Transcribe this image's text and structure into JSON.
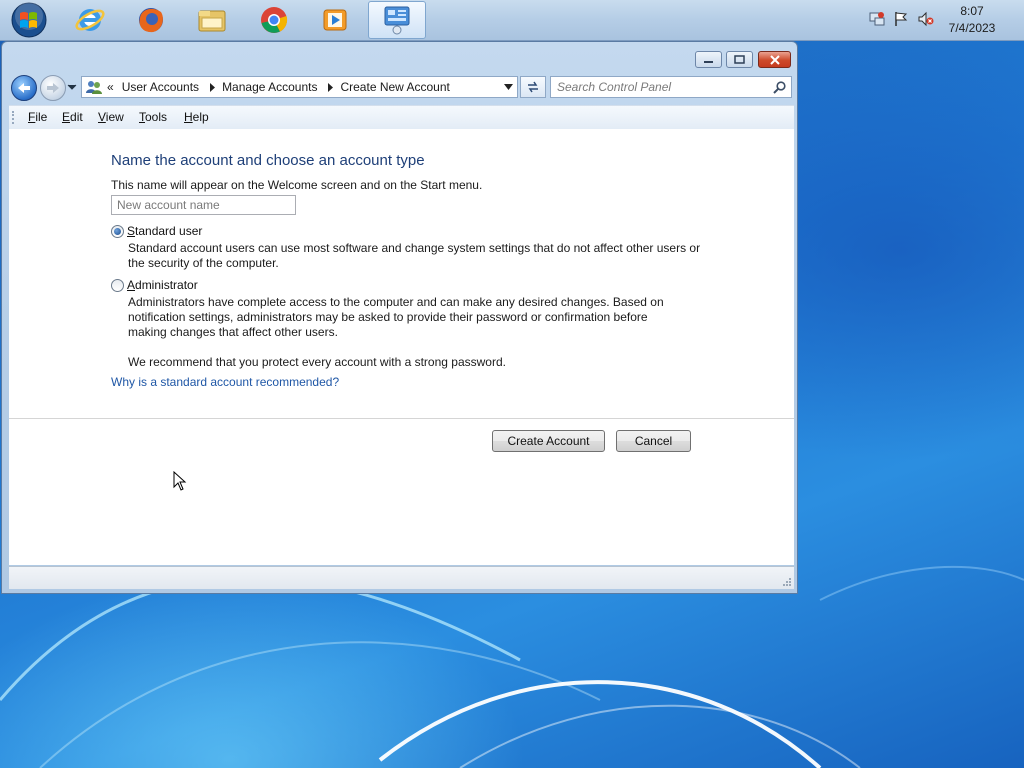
{
  "taskbar": {
    "apps": [
      {
        "name": "Start"
      },
      {
        "name": "Internet Explorer"
      },
      {
        "name": "Firefox"
      },
      {
        "name": "Windows Explorer"
      },
      {
        "name": "Chrome"
      },
      {
        "name": "Windows Media Player"
      },
      {
        "name": "Control Panel",
        "active": true
      }
    ],
    "clock": {
      "time": "8:07",
      "date": "7/4/2023"
    }
  },
  "window": {
    "breadcrumb": [
      "User Accounts",
      "Manage Accounts",
      "Create New Account"
    ],
    "breadcrumb_overflow": "«",
    "search": {
      "placeholder": "Search Control Panel"
    },
    "menu": {
      "file": {
        "ul": "F",
        "rest": "ile"
      },
      "edit": {
        "ul": "E",
        "rest": "dit"
      },
      "view": {
        "ul": "V",
        "rest": "iew"
      },
      "tools": {
        "ul": "T",
        "rest": "ools"
      },
      "help": {
        "ul": "H",
        "rest": "elp"
      }
    },
    "content": {
      "heading": "Name the account and choose an account type",
      "intro": "This name will appear on the Welcome screen and on the Start menu.",
      "name_field": {
        "placeholder": "New account name",
        "value": ""
      },
      "standard": {
        "label_ul": "S",
        "label_rest": "tandard user",
        "selected": true,
        "desc_1": "Standard account users can use most software and change system settings that do not affect other users or",
        "desc_2": "the security of the computer."
      },
      "admin": {
        "label_ul": "A",
        "label_rest": "dministrator",
        "selected": false,
        "desc_1": "Administrators have complete access to the computer and can make any desired changes. Based on",
        "desc_2": "notification settings, administrators may be asked to provide their password or confirmation before",
        "desc_3": "making changes that affect other users.",
        "recommend": "We recommend that you protect every account with a strong password."
      },
      "why_link": "Why is a standard account recommended?",
      "create_button": "Create Account",
      "cancel_button": "Cancel"
    }
  },
  "colors": {
    "heading": "#1e3f78",
    "link": "#1f57a6",
    "close_button": "#c63b1f"
  }
}
